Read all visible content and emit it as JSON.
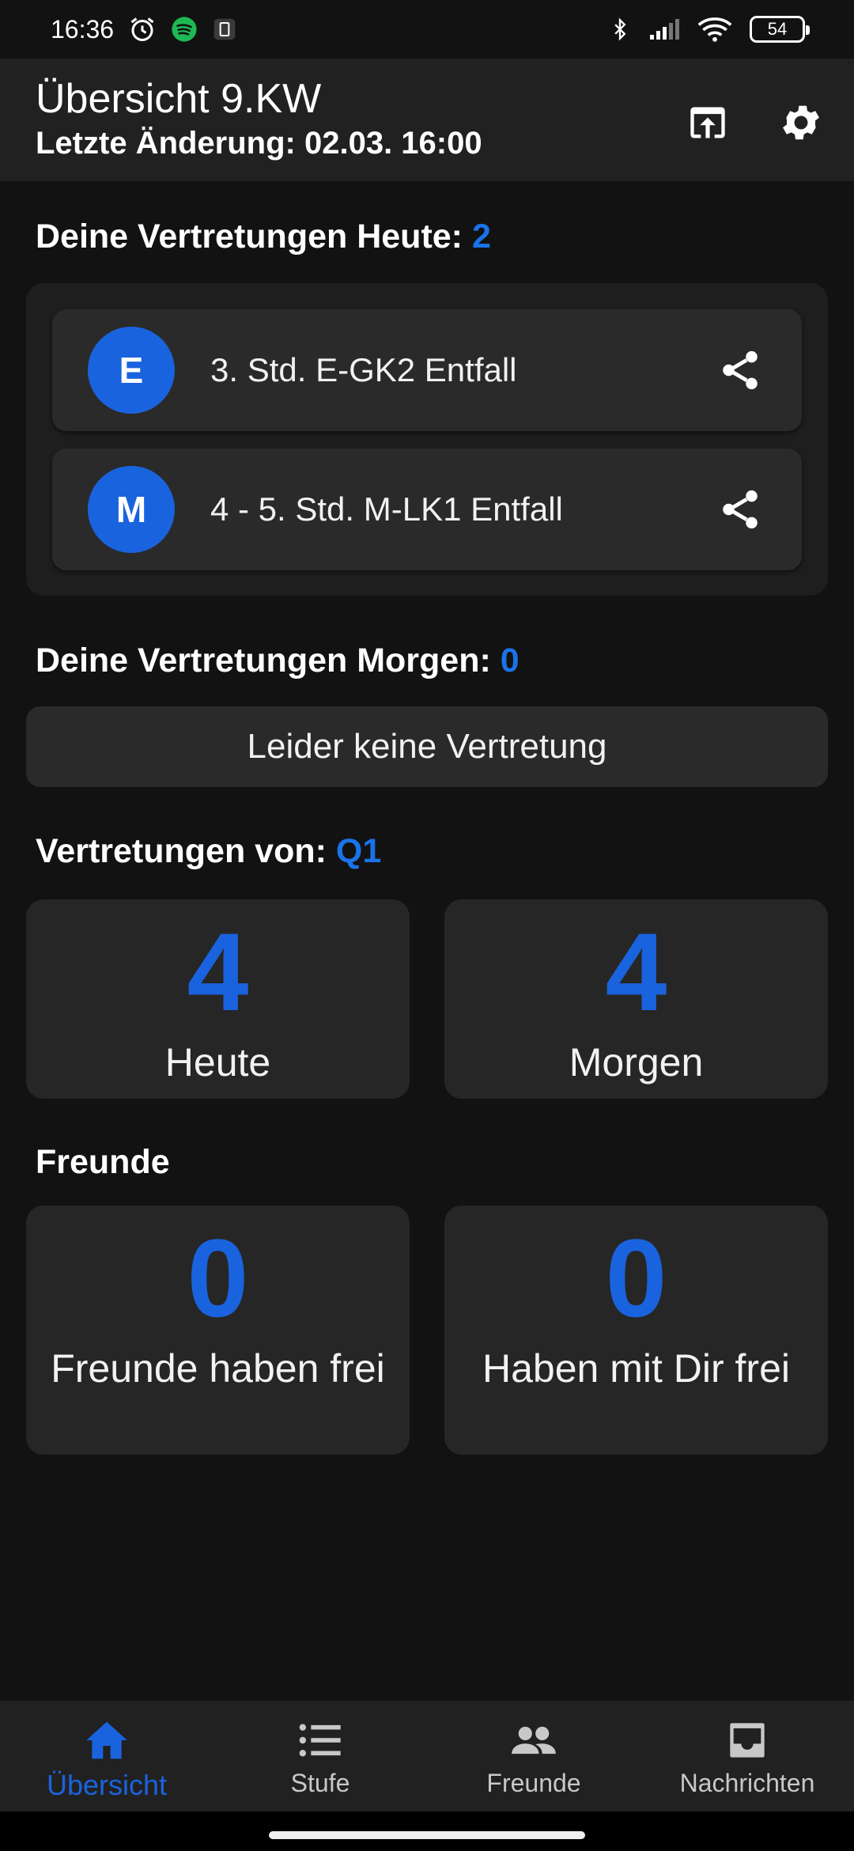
{
  "status_bar": {
    "time": "16:36",
    "battery": "54",
    "icons": [
      "alarm-icon",
      "spotify-icon",
      "app-notification-icon",
      "bluetooth-icon",
      "signal-icon",
      "wifi-icon",
      "battery-icon"
    ]
  },
  "app_bar": {
    "title": "Übersicht 9.KW",
    "subtitle": "Letzte Änderung: 02.03. 16:00",
    "actions": [
      "open-in-browser-icon",
      "settings-icon"
    ]
  },
  "today": {
    "label": "Deine Vertretungen Heute: ",
    "count": "2",
    "items": [
      {
        "initial": "E",
        "text": "3. Std. E-GK2 Entfall"
      },
      {
        "initial": "M",
        "text": "4 - 5. Std. M-LK1 Entfall"
      }
    ]
  },
  "tomorrow": {
    "label": "Deine Vertretungen Morgen: ",
    "count": "0",
    "empty_text": "Leider keine Vertretung"
  },
  "grade": {
    "label": "Vertretungen von: ",
    "value": "Q1",
    "stats": [
      {
        "number": "4",
        "label": "Heute"
      },
      {
        "number": "4",
        "label": "Morgen"
      }
    ]
  },
  "friends": {
    "label": "Freunde",
    "stats": [
      {
        "number": "0",
        "label": "Freunde haben frei"
      },
      {
        "number": "0",
        "label": "Haben mit Dir frei"
      }
    ]
  },
  "nav": {
    "items": [
      {
        "label": "Übersicht",
        "icon": "home-icon",
        "active": true
      },
      {
        "label": "Stufe",
        "icon": "list-icon",
        "active": false
      },
      {
        "label": "Freunde",
        "icon": "people-icon",
        "active": false
      },
      {
        "label": "Nachrichten",
        "icon": "inbox-icon",
        "active": false
      }
    ]
  },
  "colors": {
    "accent": "#1a63de",
    "background": "#121212",
    "surface": "#2a2a2a"
  }
}
